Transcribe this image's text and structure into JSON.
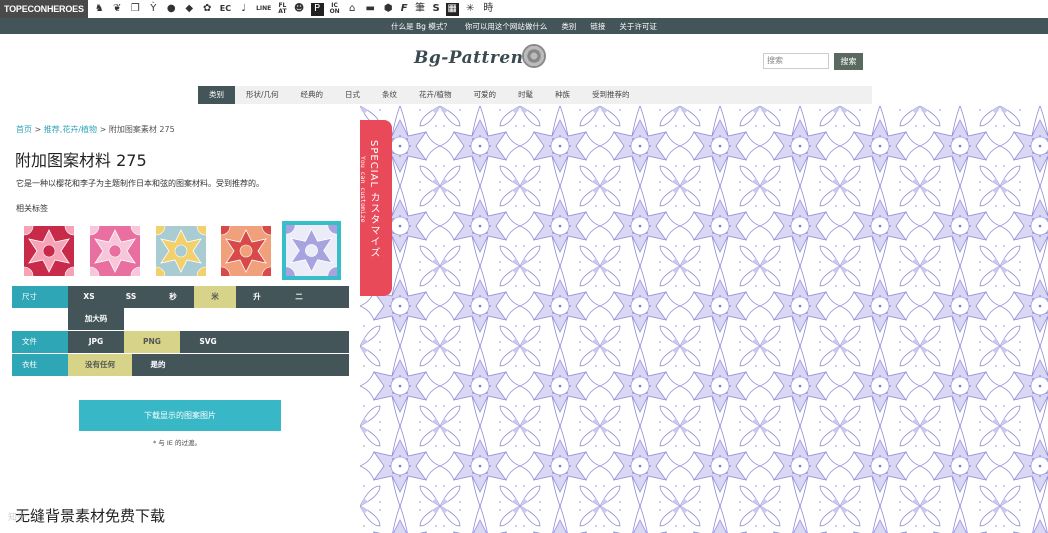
{
  "topsites": {
    "brand": "TOPECONHEROES",
    "icons": [
      "horse-icon",
      "leaf-icon",
      "copy-icon",
      "figure-icon",
      "bubble-icon",
      "bird-icon",
      "star-icon"
    ],
    "ec": "EC",
    "note_glyph": "♩",
    "line": "LINE",
    "flat_top": "FL",
    "flat_bottom": "AT",
    "smile_glyph": "☻",
    "p_glyph": "P",
    "icon_top": "IC",
    "icon_bottom": "ON",
    "house_glyph": "⌂",
    "truck_glyph": "▬",
    "hex_glyph": "⬢",
    "f_glyph": "F",
    "brush_glyph": "筆",
    "s_glyph": "S",
    "grid_glyph": "▦",
    "burst_glyph": "✳",
    "time_glyph": "時"
  },
  "infobar": [
    "什么是 Bg 模式？",
    "你可以用这个网站做什么",
    "类别",
    "链接",
    "关于许可证"
  ],
  "header": {
    "logo": "Bg-Pattrens",
    "search_placeholder": "搜索",
    "search_button": "搜索"
  },
  "categories": [
    "类别",
    "形状/几何",
    "经典的",
    "日式",
    "条纹",
    "花卉/植物",
    "可爱的",
    "时髦",
    "种族",
    "受到推荐的"
  ],
  "breadcrumb": {
    "home": "首页",
    "sep1": " > ",
    "trail": "推荐,花卉/植物",
    "sep2": " > ",
    "current": "附加图案素材 275"
  },
  "title": "附加图案材料 275",
  "description": "它是一种以樱花和李子为主题制作日本和弦的图案材料。受到推荐的。",
  "tags_label": "相关标签",
  "thumbs": [
    {
      "bg": "#c82a4a",
      "fg": "#f6a3b8"
    },
    {
      "bg": "#e86fa0",
      "fg": "#f7c6da"
    },
    {
      "bg": "#a9ccd3",
      "fg": "#f2d06b"
    },
    {
      "bg": "#f0a07a",
      "fg": "#d84a4a"
    },
    {
      "bg": "#ececf8",
      "fg": "#a7a3de"
    }
  ],
  "options": {
    "size": {
      "label": "尺寸",
      "items": [
        "XS",
        "SS",
        "秒",
        "米",
        "升",
        "二"
      ],
      "sub": "加大码"
    },
    "file": {
      "label": "文件",
      "items": [
        "JPG",
        "PNG",
        "SVG"
      ]
    },
    "color": {
      "label": "衣柱",
      "items": [
        "没有任何",
        "是的"
      ]
    }
  },
  "download": "下载显示的图案图片",
  "ie_note": "* 与 IE 的过渡。",
  "special": {
    "title": "SPECIAL カスタマイズ",
    "sub": "You can customize"
  },
  "footer": "无缝背景素材免费下载",
  "watermark": "知乎",
  "colors": {
    "dark": "#44555a",
    "teal": "#2fa6b5",
    "special": "#e84a5a",
    "pattern_bg": "#ffffff",
    "pattern_fg": "#a9a6e8"
  }
}
